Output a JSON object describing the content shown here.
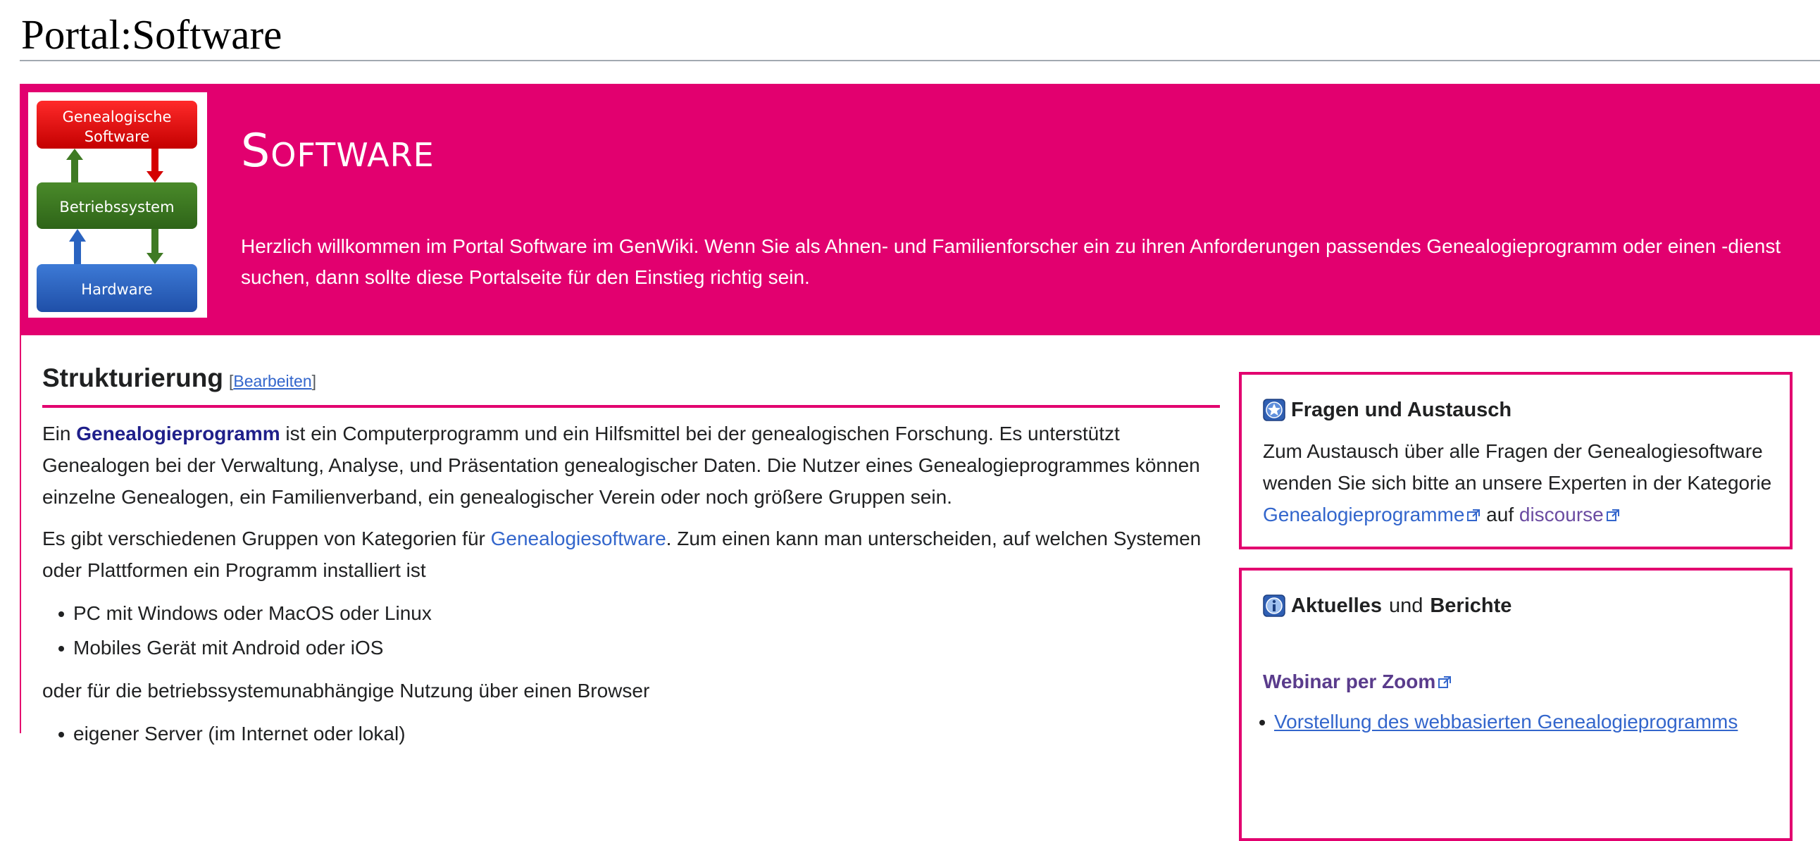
{
  "page": {
    "title": "Portal:Software"
  },
  "banner": {
    "title": "Software",
    "intro": "Herzlich willkommen im Portal Software im GenWiki. Wenn Sie als Ahnen- und Familienforscher ein zu ihren Anforderungen passendes Genealogieprogramm oder einen -dienst suchen, dann sollte diese Portalseite für den Einstieg richtig sein.",
    "diagram": {
      "top": [
        "Genealogische",
        "Software"
      ],
      "middle": "Betriebssystem",
      "bottom": "Hardware"
    }
  },
  "colors": {
    "accent": "#e2006f",
    "link": "#3366cc"
  },
  "section": {
    "heading": "Strukturierung",
    "edit_open": "[",
    "edit_label": "Bearbeiten",
    "edit_close": "]",
    "p1_pre": "Ein ",
    "p1_link": "Genealogieprogramm",
    "p1_post": " ist ein Computerprogramm und ein Hilfsmittel bei der genealogischen Forschung. Es unterstützt Genealogen bei der Verwaltung, Analyse, und Präsentation genealogischer Daten. Die Nutzer eines Genealogieprogrammes können einzelne Genealogen, ein Familienverband, ein genealogischer Verein oder noch größere Gruppen sein.",
    "p2_pre": "Es gibt verschiedenen Gruppen von Kategorien für ",
    "p2_link": "Genealogiesoftware",
    "p2_post": ". Zum einen kann man unterscheiden, auf welchen Systemen oder Plattformen ein Programm installiert ist",
    "list1": [
      "PC mit Windows oder MacOS oder Linux",
      "Mobiles Gerät mit Android oder iOS"
    ],
    "p3": "oder für die betriebssystemunabhängige Nutzung über einen Browser",
    "list2": [
      "eigener Server (im Internet oder lokal)"
    ]
  },
  "box1": {
    "icon": "star-icon",
    "heading": "Fragen und Austausch",
    "text": "Zum Austausch über alle Fragen der Genealogiesoftware wenden Sie sich bitte an unsere Experten in der Kategorie ",
    "link1": "Genealogieprogramme",
    "mid": " auf ",
    "link2": "discourse"
  },
  "box2": {
    "icon": "info-icon",
    "heading_a": "Aktuelles",
    "heading_mid": "und",
    "heading_b": "Berichte",
    "webinar": "Webinar per Zoom",
    "items": [
      "Vorstellung des webbasierten Genealogieprogramms"
    ]
  }
}
